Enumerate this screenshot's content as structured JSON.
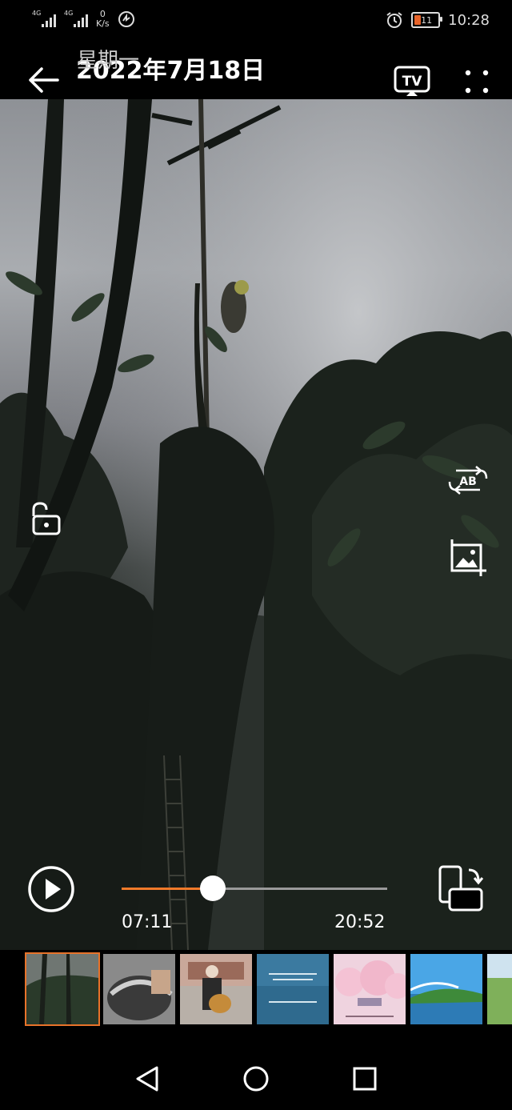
{
  "status_bar": {
    "network_1": "4G",
    "network_2": "4G",
    "speed_value": "0",
    "speed_unit": "K/s",
    "battery_level": "11",
    "time": "10:28",
    "icons": [
      "signal-icon",
      "signal-icon",
      "data-saver-icon",
      "alarm-icon",
      "battery-icon"
    ]
  },
  "header": {
    "title": "2022年7月18日",
    "subtitle": "星期一",
    "tv_label": "TV",
    "icons": [
      "back-arrow-icon",
      "tv-cast-icon",
      "more-icon"
    ]
  },
  "overlay_controls": {
    "ab_label": "AB",
    "icons": [
      "unlock-icon",
      "ab-repeat-icon",
      "screenshot-icon"
    ]
  },
  "player": {
    "current_time": "07:11",
    "total_time": "20:52",
    "progress": 0.344,
    "icons": [
      "play-icon",
      "rotate-screen-icon"
    ],
    "colors": {
      "progress_fill": "#f07a2a",
      "progress_track": "#9a9a9a",
      "active_thumb": "#e8732a"
    }
  },
  "thumbnails": {
    "selected_index": 0,
    "items": [
      {
        "kind": "forest-video"
      },
      {
        "kind": "helmet-photo"
      },
      {
        "kind": "guitar-photo"
      },
      {
        "kind": "blue-text-card"
      },
      {
        "kind": "cherry-blossom-card"
      },
      {
        "kind": "lake-landscape"
      },
      {
        "kind": "green-meadow"
      }
    ]
  },
  "nav_bar": {
    "icons": [
      "back-triangle-icon",
      "home-circle-icon",
      "recents-square-icon"
    ]
  }
}
